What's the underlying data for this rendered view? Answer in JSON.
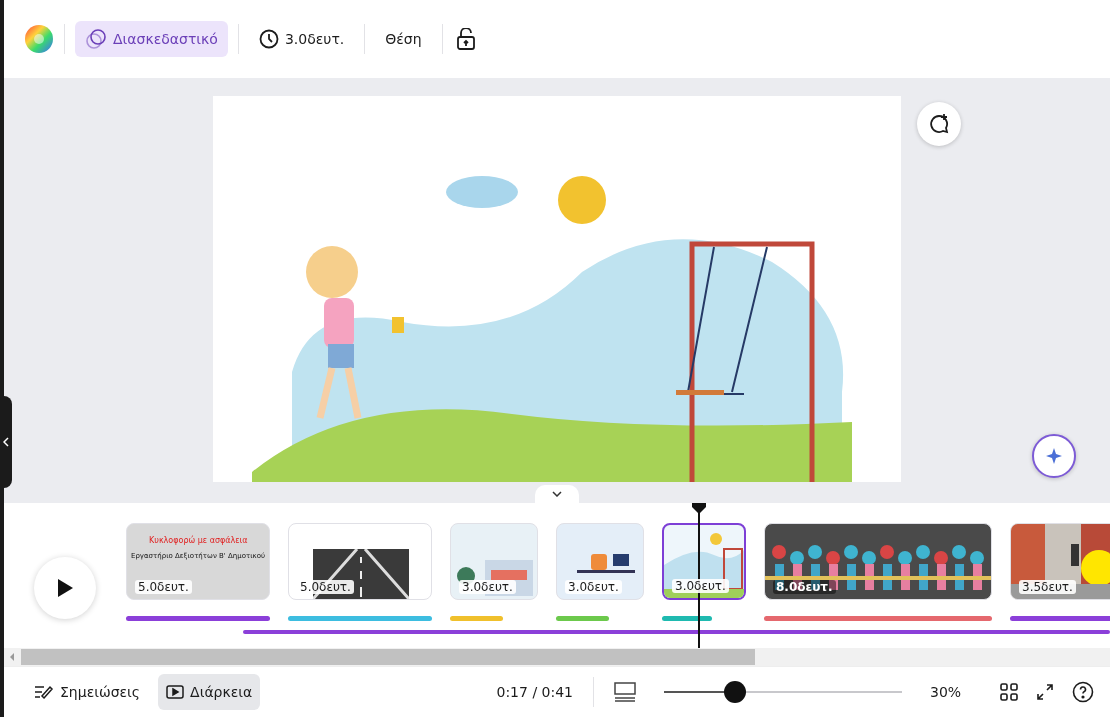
{
  "toolbar": {
    "animation": {
      "label": "Διασκεδαστικό",
      "selected": true
    },
    "duration": "3.0δευτ.",
    "position": "Θέση"
  },
  "timeline": {
    "slides": [
      {
        "kind": "title",
        "duration": "5.0δευτ.",
        "title": "Κυκλοφορώ με ασφάλεια",
        "subtitle": "Εργαστήριο Δεξιοτήτων Β' Δημοτικού",
        "color": "#8b3fd9",
        "selected": false
      },
      {
        "kind": "road",
        "duration": "5.0δευτ.",
        "color": "#3dbde0",
        "selected": false
      },
      {
        "kind": "school",
        "duration": "3.0δευτ.",
        "color": "#f0c02c",
        "selected": false
      },
      {
        "kind": "office",
        "duration": "3.0δευτ.",
        "color": "#6cc94c",
        "selected": false
      },
      {
        "kind": "park",
        "duration": "3.0δευτ.",
        "color": "#1fbab0",
        "selected": true
      },
      {
        "kind": "signs",
        "duration": "8.0δευτ.",
        "color": "#e5686e",
        "selected": false
      },
      {
        "kind": "street",
        "duration": "3.5δευτ.",
        "color": "#8b3fd9",
        "selected": false
      }
    ]
  },
  "footer": {
    "notes": "Σημειώσεις",
    "duration": {
      "label": "Διάρκεια",
      "selected": true
    },
    "time": "0:17 / 0:41",
    "zoom": {
      "level": 0.3,
      "reading": "30%"
    }
  }
}
